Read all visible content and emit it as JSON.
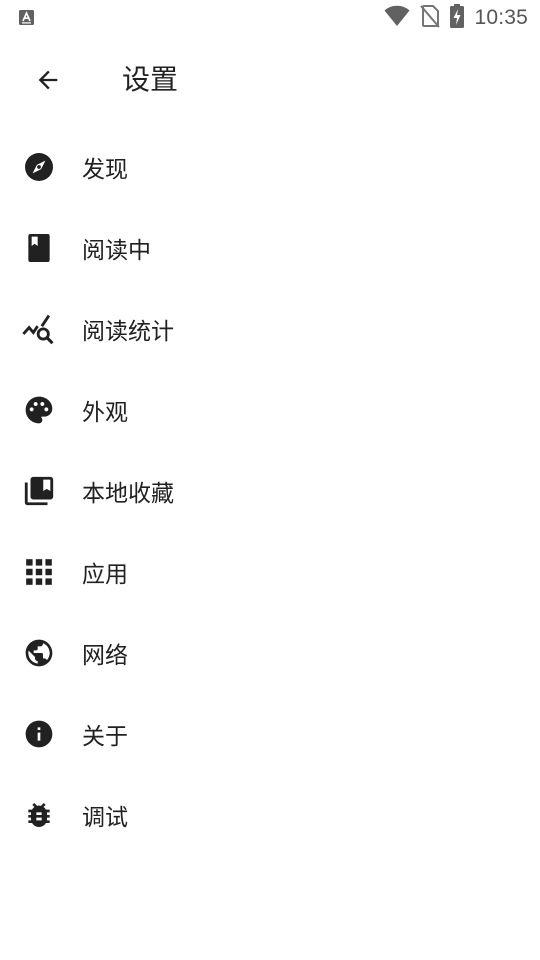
{
  "status_bar": {
    "time": "10:35",
    "left_icon": "keyboard-a-icon",
    "icons": [
      "wifi-icon",
      "no-sim-icon",
      "battery-charging-icon"
    ]
  },
  "app_bar": {
    "back_icon": "arrow-back-icon",
    "title": "设置"
  },
  "menu": {
    "items": [
      {
        "label": "发现",
        "icon": "compass-icon"
      },
      {
        "label": "阅读中",
        "icon": "book-icon"
      },
      {
        "label": "阅读统计",
        "icon": "chart-search-icon"
      },
      {
        "label": "外观",
        "icon": "palette-icon"
      },
      {
        "label": "本地收藏",
        "icon": "collections-bookmark-icon"
      },
      {
        "label": "应用",
        "icon": "apps-grid-icon"
      },
      {
        "label": "网络",
        "icon": "globe-icon"
      },
      {
        "label": "关于",
        "icon": "info-icon"
      },
      {
        "label": "调试",
        "icon": "bug-icon"
      }
    ]
  },
  "colors": {
    "icon": "#212121",
    "text": "#212121",
    "status_text": "#555555",
    "background": "#ffffff"
  }
}
